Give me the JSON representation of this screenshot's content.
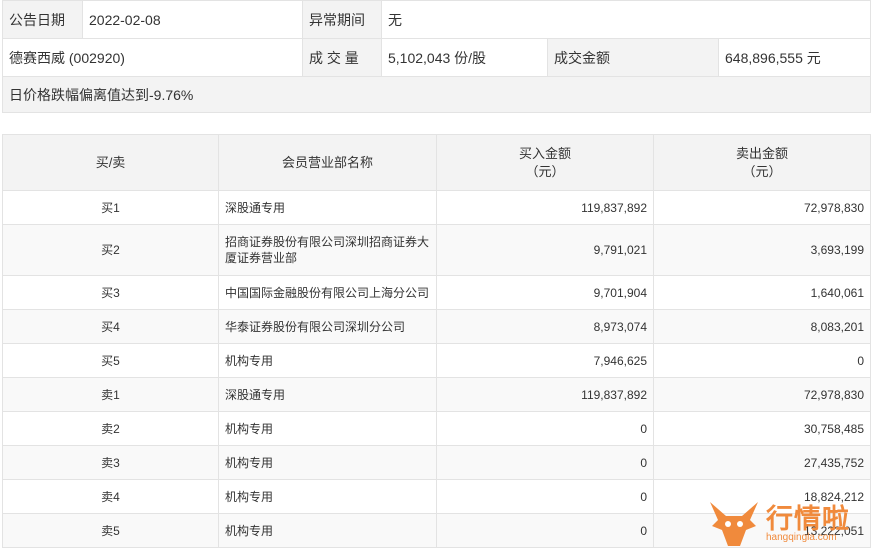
{
  "info": {
    "date_label": "公告日期",
    "date_value": "2022-02-08",
    "period_label": "异常期间",
    "period_value": "无",
    "stock": "德赛西威 (002920)",
    "volume_label": "成 交 量",
    "volume_value": "5,102,043 份/股",
    "amount_label": "成交金额",
    "amount_value": "648,896,555 元",
    "reason": "日价格跌幅偏离值达到-9.76%"
  },
  "table": {
    "headers": [
      "买/卖",
      "会员营业部名称",
      "买入金额\n（元）",
      "卖出金额\n（元）"
    ],
    "rows": [
      {
        "side": "买1",
        "name": "深股通专用",
        "buy": "119,837,892",
        "sell": "72,978,830"
      },
      {
        "side": "买2",
        "name": "招商证券股份有限公司深圳招商证券大厦证券营业部",
        "buy": "9,791,021",
        "sell": "3,693,199"
      },
      {
        "side": "买3",
        "name": "中国国际金融股份有限公司上海分公司",
        "buy": "9,701,904",
        "sell": "1,640,061"
      },
      {
        "side": "买4",
        "name": "华泰证券股份有限公司深圳分公司",
        "buy": "8,973,074",
        "sell": "8,083,201"
      },
      {
        "side": "买5",
        "name": "机构专用",
        "buy": "7,946,625",
        "sell": "0"
      },
      {
        "side": "卖1",
        "name": "深股通专用",
        "buy": "119,837,892",
        "sell": "72,978,830"
      },
      {
        "side": "卖2",
        "name": "机构专用",
        "buy": "0",
        "sell": "30,758,485"
      },
      {
        "side": "卖3",
        "name": "机构专用",
        "buy": "0",
        "sell": "27,435,752"
      },
      {
        "side": "卖4",
        "name": "机构专用",
        "buy": "0",
        "sell": "18,824,212"
      },
      {
        "side": "卖5",
        "name": "机构专用",
        "buy": "0",
        "sell": "13,222,051"
      }
    ]
  },
  "watermark": {
    "logo_text": "行情啦",
    "site": "hangqingla.com",
    "colors": {
      "accent": "#f08a3c"
    }
  }
}
